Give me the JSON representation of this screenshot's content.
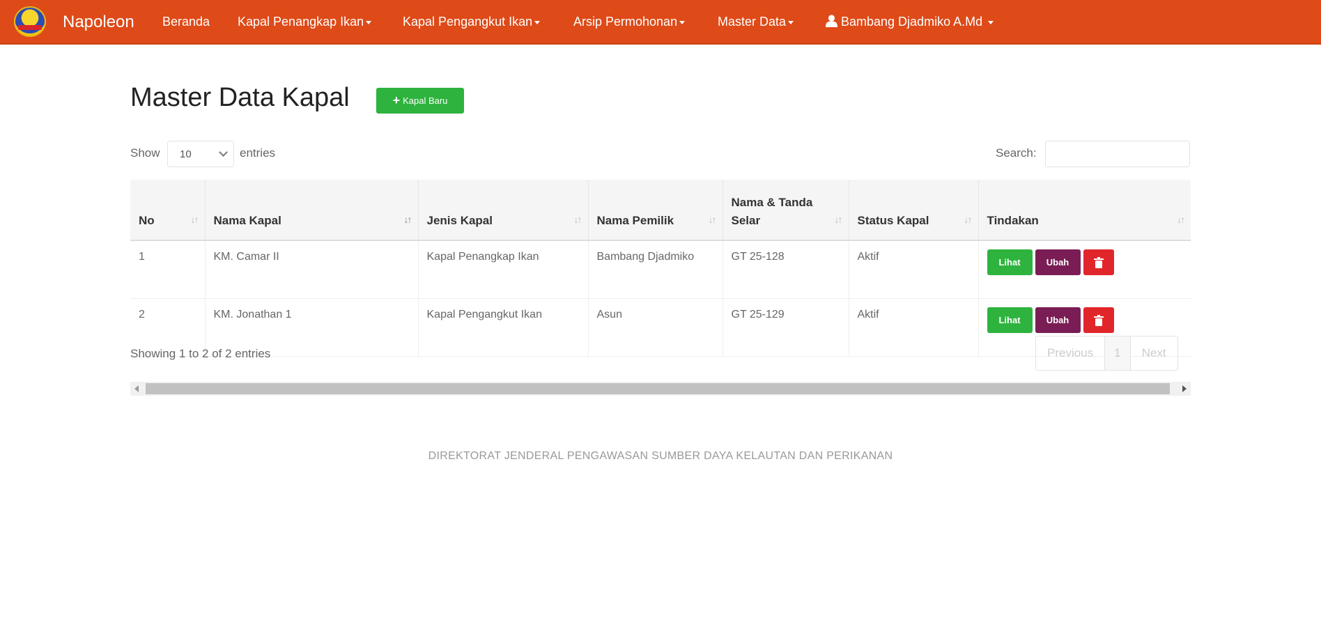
{
  "navbar": {
    "brand": "Napoleon",
    "items": [
      {
        "label": "Beranda"
      },
      {
        "label": "Kapal Penangkap Ikan"
      },
      {
        "label": "Kapal Pengangkut Ikan"
      },
      {
        "label": "Arsip Permohonan"
      },
      {
        "label": "Master Data"
      }
    ],
    "user": "Bambang Djadmiko A.Md"
  },
  "page": {
    "title": "Master Data Kapal",
    "add_button": "Kapal Baru"
  },
  "controls": {
    "show_label": "Show",
    "entries_value": "10",
    "entries_label": "entries",
    "search_label": "Search:",
    "search_value": ""
  },
  "table": {
    "headers": [
      "No",
      "Nama Kapal",
      "Jenis Kapal",
      "Nama Pemilik",
      "Nama & Tanda Selar",
      "Status Kapal",
      "Tindakan"
    ],
    "rows": [
      {
        "no": "1",
        "nama": "KM. Camar II",
        "jenis": "Kapal Penangkap Ikan",
        "pemilik": "Bambang Djadmiko",
        "selar": "GT 25-128",
        "status": "Aktif"
      },
      {
        "no": "2",
        "nama": "KM. Jonathan 1",
        "jenis": "Kapal Pengangkut Ikan",
        "pemilik": "Asun",
        "selar": "GT 25-129",
        "status": "Aktif"
      }
    ],
    "actions": {
      "view": "Lihat",
      "edit": "Ubah"
    }
  },
  "pagination": {
    "info": "Showing 1 to 2 of 2 entries",
    "previous": "Previous",
    "current": "1",
    "next": "Next"
  },
  "footer": "DIREKTORAT JENDERAL PENGAWASAN SUMBER DAYA KELAUTAN DAN PERIKANAN",
  "colors": {
    "navbar": "#de4a18",
    "success": "#2eb33e",
    "edit": "#7a1d54",
    "danger": "#e0262a"
  }
}
